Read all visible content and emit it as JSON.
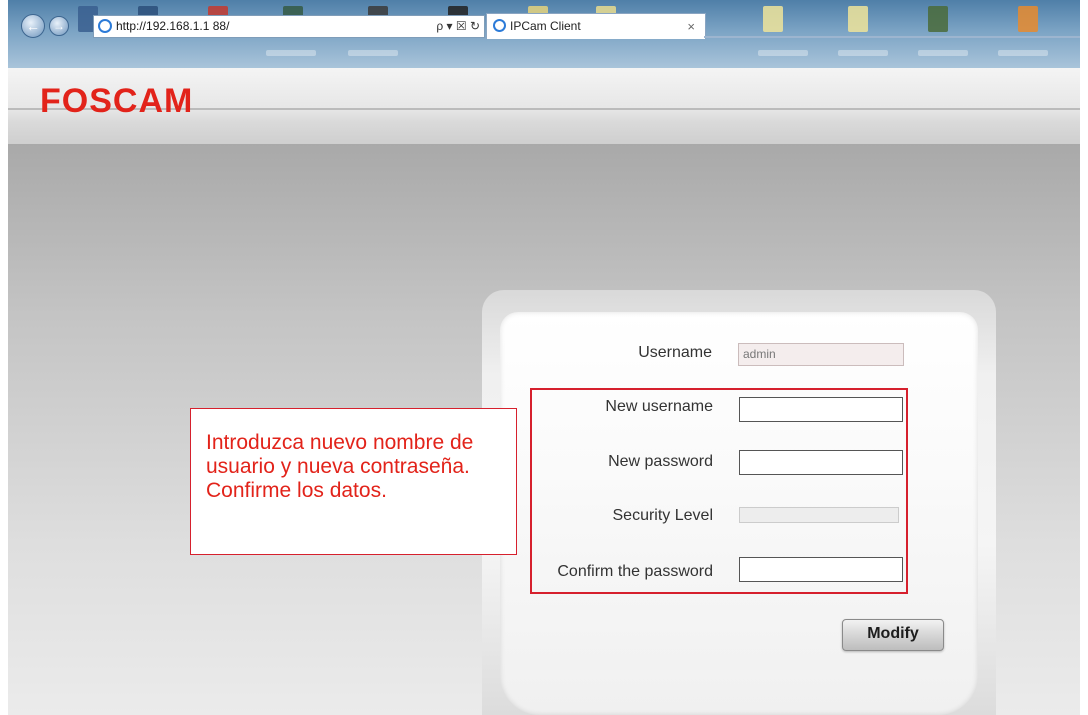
{
  "browser": {
    "address_url": "http://192.168.1.1 88/",
    "address_tools": "ρ ▾ ☒ ↻",
    "tab_title": "IPCam Client",
    "tab_close": "×"
  },
  "header": {
    "logo_text": "FOSCAM"
  },
  "form": {
    "username_label": "Username",
    "username_value": "admin",
    "new_username_label": "New username",
    "new_password_label": "New password",
    "security_level_label": "Security Level",
    "confirm_password_label": "Confirm the password",
    "modify_button": "Modify"
  },
  "annotation": {
    "callout_text": "Introduzca nuevo nombre de usuario y nueva contraseña. Confirme los datos.",
    "color": "#e2231a"
  },
  "colors": {
    "brand_red": "#e2231a"
  }
}
